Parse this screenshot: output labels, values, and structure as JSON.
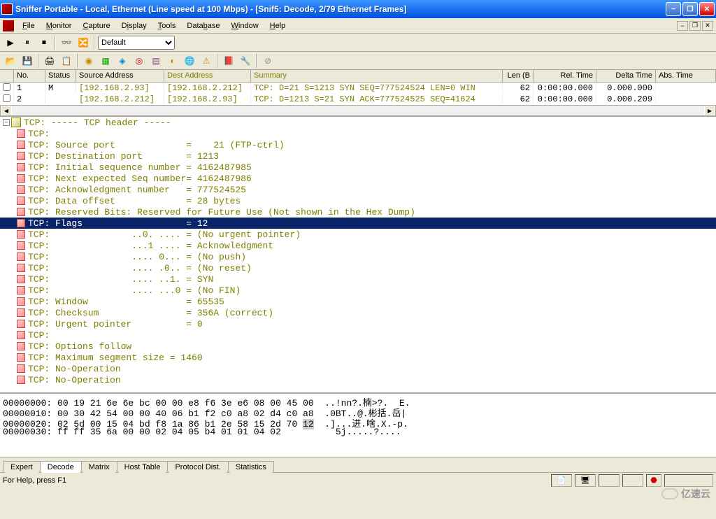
{
  "window": {
    "title": "Sniffer Portable - Local, Ethernet (Line speed at 100 Mbps) - [Snif5: Decode, 2/79 Ethernet Frames]"
  },
  "menu": {
    "file": "File",
    "monitor": "Monitor",
    "capture": "Capture",
    "display": "Display",
    "tools": "Tools",
    "database": "Database",
    "window": "Window",
    "help": "Help"
  },
  "toolbar1": {
    "combo": "Default"
  },
  "grid": {
    "headers": {
      "no": "No.",
      "status": "Status",
      "src": "Source Address",
      "dst": "Dest Address",
      "summary": "Summary",
      "len": "Len (B",
      "rel": "Rel. Time",
      "delta": "Delta Time",
      "abs": "Abs. Time"
    },
    "rows": [
      {
        "no": "1",
        "status": "M",
        "src": "[192.168.2.93]",
        "dst": "[192.168.2.212]",
        "summary": "TCP: D=21 S=1213 SYN SEQ=777524524 LEN=0 WIN",
        "len": "62",
        "rel": "0:00:00.000",
        "delta": "0.000.000"
      },
      {
        "no": "2",
        "status": "",
        "src": "[192.168.2.212]",
        "dst": "[192.168.2.93]",
        "summary": "TCP: D=1213 S=21 SYN ACK=777524525 SEQ=41624",
        "len": "62",
        "rel": "0:00:00.000",
        "delta": "0.000.209"
      }
    ]
  },
  "decode": {
    "header": "TCP: ----- TCP header -----",
    "lines": [
      {
        "t": "TCP:"
      },
      {
        "t": "TCP: Source port             =    21 (FTP-ctrl)"
      },
      {
        "t": "TCP: Destination port        = 1213"
      },
      {
        "t": "TCP: Initial sequence number = 4162487985"
      },
      {
        "t": "TCP: Next expected Seq number= 4162487986"
      },
      {
        "t": "TCP: Acknowledgment number   = 777524525"
      },
      {
        "t": "TCP: Data offset             = 28 bytes"
      },
      {
        "t": "TCP: Reserved Bits: Reserved for Future Use (Not shown in the Hex Dump)"
      },
      {
        "t": "TCP: Flags                   = 12",
        "sel": true
      },
      {
        "t": "TCP:               ..0. .... = (No urgent pointer)"
      },
      {
        "t": "TCP:               ...1 .... = Acknowledgment"
      },
      {
        "t": "TCP:               .... 0... = (No push)"
      },
      {
        "t": "TCP:               .... .0.. = (No reset)"
      },
      {
        "t": "TCP:               .... ..1. = SYN"
      },
      {
        "t": "TCP:               .... ...0 = (No FIN)"
      },
      {
        "t": "TCP: Window                  = 65535"
      },
      {
        "t": "TCP: Checksum                = 356A (correct)"
      },
      {
        "t": "TCP: Urgent pointer          = 0"
      },
      {
        "t": "TCP:"
      },
      {
        "t": "TCP: Options follow"
      },
      {
        "t": "TCP: Maximum segment size = 1460"
      },
      {
        "t": "TCP: No-Operation"
      },
      {
        "t": "TCP: No-Operation"
      }
    ]
  },
  "hex": {
    "lines": [
      {
        "off": "00000000:",
        "b": "00 19 21 6e 6e bc 00 00 e8 f6 3e e6 08 00 45 00",
        "a": "..!nn?.楠>?.  E."
      },
      {
        "off": "00000010:",
        "b": "00 30 42 54 00 00 40 06 b1 f2 c0 a8 02 d4 c0 a8",
        "a": ".0BT..@.彬括.岳|"
      },
      {
        "off": "00000020:",
        "b": "02 5d 00 15 04 bd f8 1a 86 b1 2e 58 15 2d 70 ",
        "hi": "12",
        "a": ".]...进.啥.X.-p."
      },
      {
        "off": "00000030:",
        "b": "ff ff 35 6a 00 00 02 04 05 b4 01 01 04 02      ",
        "a": "  5j.....?...."
      }
    ]
  },
  "tabs": {
    "items": [
      "Expert",
      "Decode",
      "Matrix",
      "Host Table",
      "Protocol Dist.",
      "Statistics"
    ],
    "active": 1
  },
  "status": {
    "msg": "For Help, press F1"
  },
  "watermark": "亿速云"
}
